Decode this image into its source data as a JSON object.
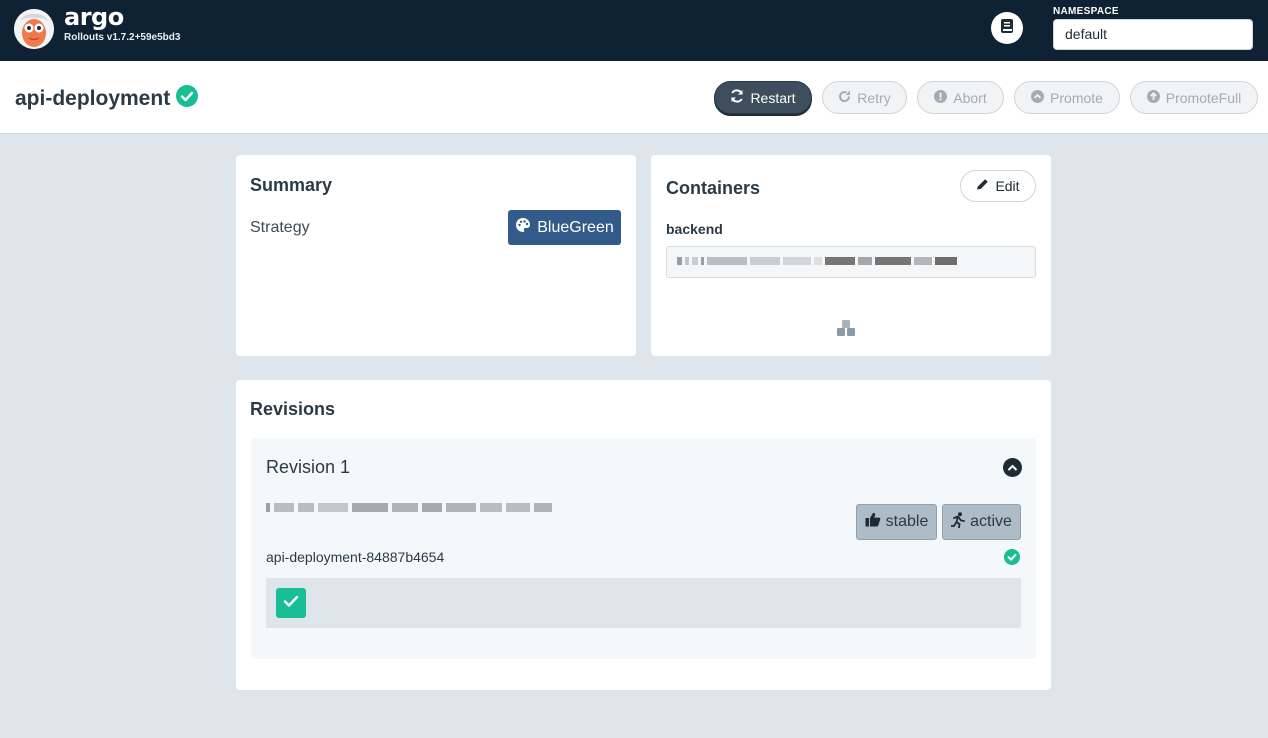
{
  "topbar": {
    "brand_name": "argo",
    "version": "Rollouts v1.7.2+59e5bd3",
    "namespace_label": "NAMESPACE",
    "namespace_value": "default"
  },
  "header": {
    "title": "api-deployment",
    "buttons": {
      "restart": "Restart",
      "retry": "Retry",
      "abort": "Abort",
      "promote": "Promote",
      "promote_full": "PromoteFull"
    }
  },
  "summary": {
    "title": "Summary",
    "strategy_label": "Strategy",
    "strategy_value": "BlueGreen"
  },
  "containers": {
    "title": "Containers",
    "edit_label": "Edit",
    "items": [
      {
        "name": "backend"
      }
    ]
  },
  "revisions": {
    "title": "Revisions",
    "items": [
      {
        "title": "Revision 1",
        "tags": [
          "stable",
          "active"
        ],
        "replicaset": "api-deployment-84887b4654"
      }
    ]
  },
  "colors": {
    "topbar": "#0e2233",
    "success": "#18be94",
    "strategy": "#335b8a",
    "tag": "#aebcc7"
  }
}
